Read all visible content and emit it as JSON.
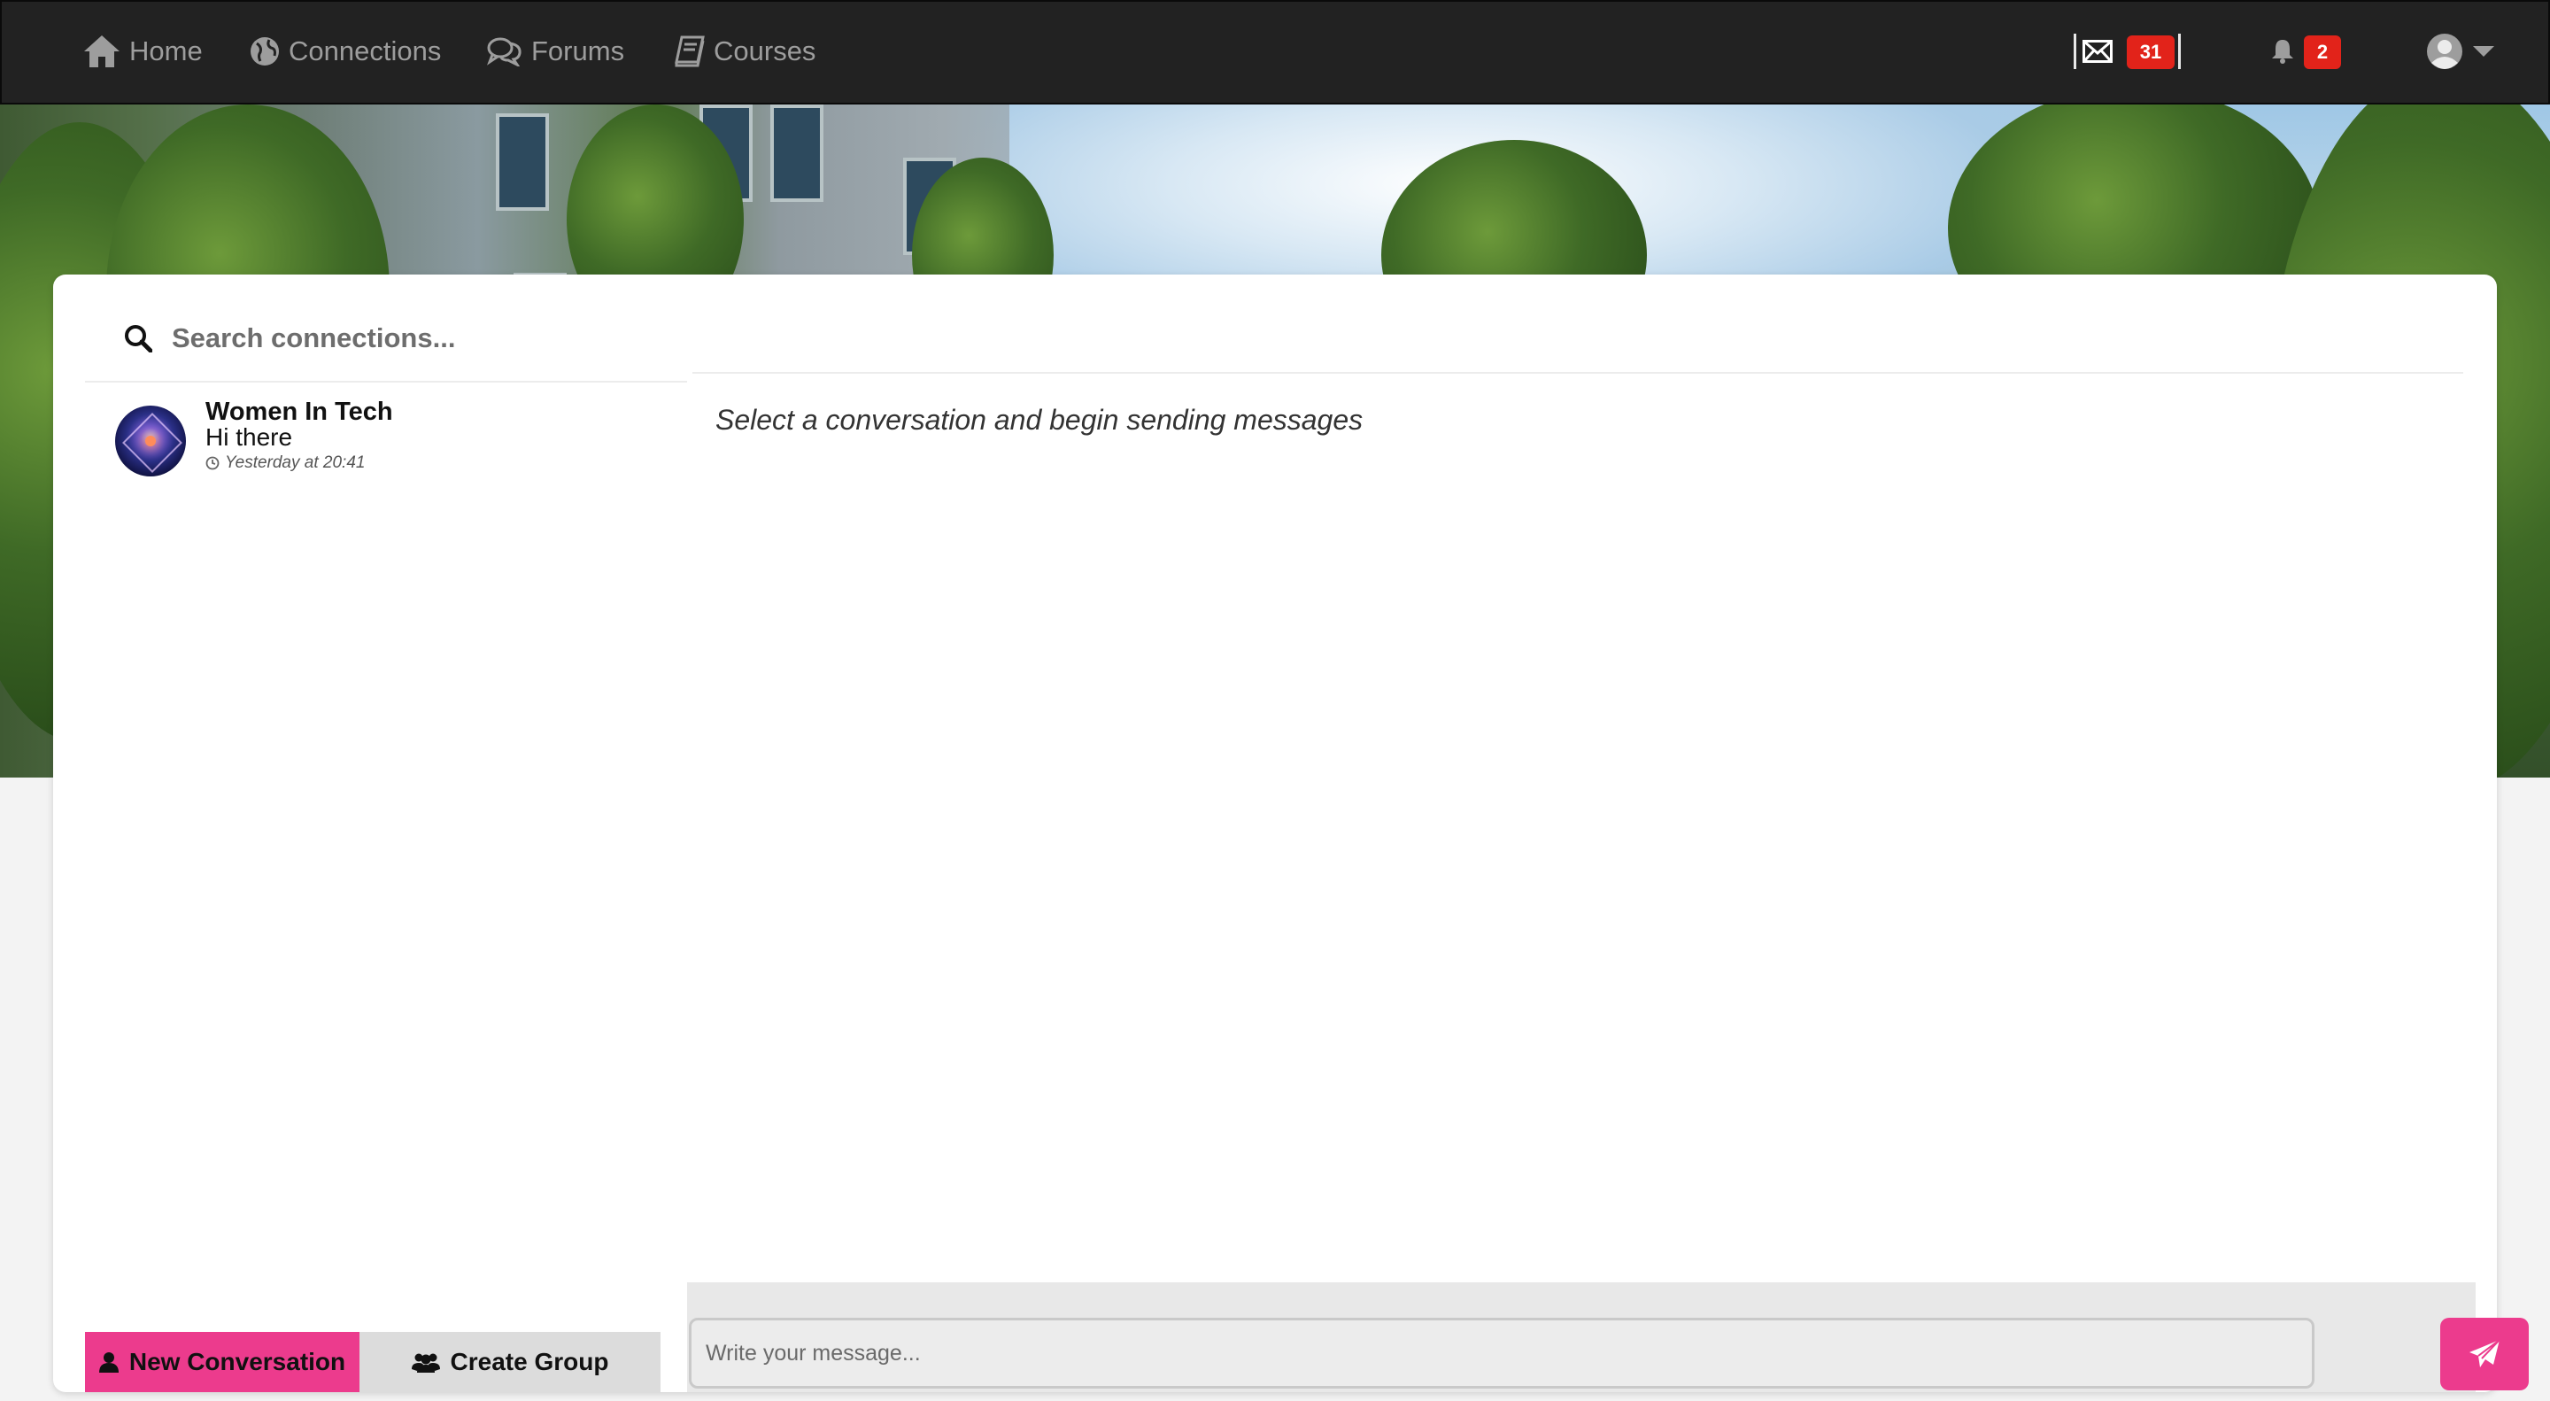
{
  "nav": {
    "home_label": "Home",
    "connections_label": "Connections",
    "forums_label": "Forums",
    "courses_label": "Courses",
    "messages_count": "31",
    "notifications_count": "2",
    "icons": [
      "home-icon",
      "globe-icon",
      "comments-icon",
      "book-icon",
      "envelope-icon",
      "bell-icon",
      "user-avatar-icon",
      "caret-down-icon"
    ]
  },
  "sidebar": {
    "search_placeholder": "Search connections...",
    "conversations": [
      {
        "name": "Women In Tech",
        "last_message": "Hi there",
        "timestamp": "Yesterday at 20:41"
      }
    ],
    "new_conversation_label": "New Conversation",
    "create_group_label": "Create Group"
  },
  "main": {
    "empty_hint": "Select a conversation and begin sending messages",
    "message_placeholder": "Write your message..."
  },
  "colors": {
    "navbar_bg": "#222222",
    "nav_text": "#9d9d9d",
    "badge_red": "#e2231a",
    "accent_pink": "#ec3b8d",
    "secondary_button": "#dcdcdc"
  }
}
